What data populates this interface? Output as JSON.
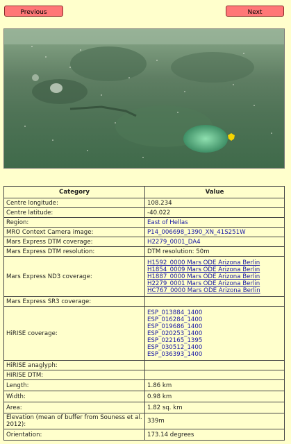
{
  "nav": {
    "previous_label": "Previous",
    "next_label": "Next"
  },
  "map": {
    "description_icon": "mars-map-image",
    "marker_color": "#f5d400"
  },
  "table": {
    "headers": {
      "category": "Category",
      "value": "Value"
    },
    "rows": [
      {
        "key": "centre_longitude",
        "category": "Centre longitude:",
        "values": [
          "108.234"
        ],
        "link": false
      },
      {
        "key": "centre_latitude",
        "category": "Centre latitude:",
        "values": [
          "-40.022"
        ],
        "link": false
      },
      {
        "key": "region",
        "category": "Region:",
        "values": [
          "East of Hellas"
        ],
        "link": "region"
      },
      {
        "key": "mro_ctx",
        "category": "MRO Context Camera image:",
        "values": [
          "P14_006698_1390_XN_41S251W"
        ],
        "link": true
      },
      {
        "key": "mex_dtm_cov",
        "category": "Mars Express DTM coverage:",
        "values": [
          "H2279_0001_DA4"
        ],
        "link": true
      },
      {
        "key": "mex_dtm_res",
        "category": "Mars Express DTM resolution:",
        "values": [
          "DTM resolution: 50m"
        ],
        "link": false
      },
      {
        "key": "mex_nd3",
        "category": "Mars Express ND3 coverage:",
        "values": [
          "H1592_0000 Mars ODE Arizona Berlin",
          "H1854_0009 Mars ODE Arizona Berlin",
          "H1887_0000 Mars ODE Arizona Berlin",
          "H2279_0001 Mars ODE Arizona Berlin",
          "HC767_0000 Mars ODE Arizona Berlin"
        ],
        "link": "underline"
      },
      {
        "key": "mex_sr3",
        "category": "Mars Express SR3 coverage:",
        "values": [
          ""
        ],
        "link": false
      },
      {
        "key": "hirise_cov",
        "category": "HiRISE coverage:",
        "values": [
          "ESP_013884_1400",
          "ESP_016284_1400",
          "ESP_019686_1400",
          "ESP_020253_1400",
          "ESP_022165_1395",
          "ESP_030512_1400",
          "ESP_036393_1400"
        ],
        "link": true
      },
      {
        "key": "hirise_ana",
        "category": "HiRISE anaglyph:",
        "values": [
          ""
        ],
        "link": false
      },
      {
        "key": "hirise_dtm",
        "category": "HiRISE DTM:",
        "values": [
          ""
        ],
        "link": false
      },
      {
        "key": "length",
        "category": "Length:",
        "values": [
          "1.86 km"
        ],
        "link": false
      },
      {
        "key": "width",
        "category": "Width:",
        "values": [
          "0.98 km"
        ],
        "link": false
      },
      {
        "key": "area",
        "category": "Area:",
        "values": [
          "1.82 sq. km"
        ],
        "link": false
      },
      {
        "key": "elevation",
        "category": "Elevation (mean of buffer from Souness et al. 2012):",
        "values": [
          "339m"
        ],
        "link": false
      },
      {
        "key": "orientation",
        "category": "Orientation:",
        "values": [
          "173.14 degrees"
        ],
        "link": false
      }
    ]
  }
}
